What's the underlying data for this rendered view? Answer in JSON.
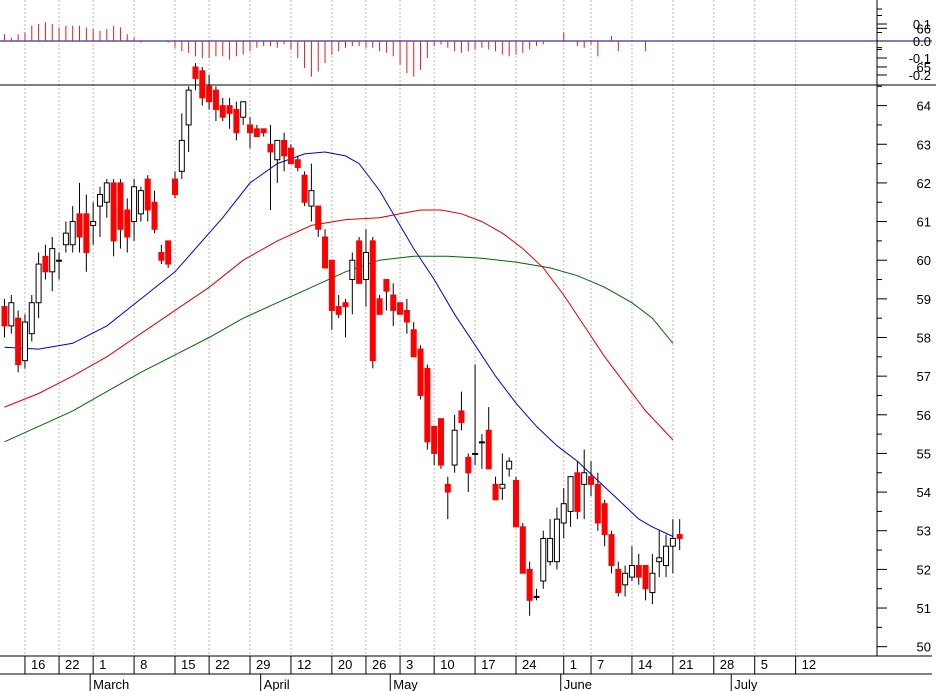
{
  "chart_data": [
    {
      "type": "bar",
      "panel": "oscillator",
      "ylim": [
        -0.25,
        0.15
      ],
      "ticks": [
        0.1,
        0.0,
        -0.1,
        -0.2
      ],
      "tick_labels": [
        "0.1",
        "0.0",
        "-0.1",
        "-0.2"
      ],
      "zero_line": true,
      "colors": {
        "positive": "#e02020",
        "negative": "#e02020",
        "zero_line": "#000080"
      },
      "values": [
        0.04,
        0.02,
        0.04,
        0.05,
        0.09,
        0.1,
        0.11,
        0.1,
        0.08,
        0.09,
        0.09,
        0.09,
        0.08,
        0.07,
        0.06,
        0.07,
        0.09,
        0.08,
        0.04,
        0.02,
        -0.01,
        0.0,
        0.0,
        0.0,
        -0.01,
        -0.04,
        -0.06,
        -0.07,
        -0.09,
        -0.1,
        -0.1,
        -0.09,
        -0.09,
        -0.11,
        -0.09,
        -0.08,
        -0.06,
        -0.04,
        -0.03,
        -0.03,
        -0.04,
        -0.02,
        -0.05,
        -0.1,
        -0.16,
        -0.21,
        -0.18,
        -0.13,
        -0.08,
        -0.06,
        -0.04,
        -0.03,
        -0.03,
        -0.04,
        -0.04,
        -0.06,
        -0.07,
        -0.09,
        -0.14,
        -0.19,
        -0.21,
        -0.17,
        -0.1,
        -0.03,
        -0.02,
        -0.04,
        -0.06,
        -0.07,
        -0.06,
        -0.05,
        -0.04,
        -0.05,
        -0.06,
        -0.08,
        -0.09,
        -0.08,
        -0.07,
        -0.05,
        -0.03,
        -0.02,
        0.0,
        0.0,
        0.05,
        0.0,
        -0.03,
        -0.04,
        -0.02,
        -0.09,
        0.0,
        0.03,
        -0.06,
        0.0,
        0.0,
        0.0,
        -0.06
      ]
    },
    {
      "type": "candlestick",
      "panel": "price",
      "ylim": [
        49.5,
        66.5
      ],
      "y_ticks": [
        50,
        51,
        52,
        53,
        54,
        55,
        56,
        57,
        58,
        59,
        60,
        61,
        62,
        63,
        64,
        65,
        66
      ],
      "y_tick_labels": [
        "50",
        "51",
        "52",
        "53",
        "54",
        "55",
        "56",
        "57",
        "58",
        "59",
        "60",
        "61",
        "62",
        "63",
        "64",
        "65",
        "66"
      ],
      "grid": "vertical dotted",
      "x_day_labels": [
        "16",
        "22",
        "1",
        "8",
        "15",
        "22",
        "29",
        "12",
        "20",
        "26",
        "3",
        "10",
        "17",
        "24",
        "1",
        "7",
        "14",
        "21",
        "28",
        "5",
        "12"
      ],
      "x_day_label_bars": [
        3,
        8,
        13,
        19,
        25,
        30,
        36,
        42,
        48,
        53,
        58,
        63,
        69,
        75,
        82,
        86,
        92,
        98,
        104,
        110,
        116
      ],
      "x_month_labels": [
        "March",
        "April",
        "May",
        "June",
        "July"
      ],
      "x_month_label_bars": [
        13,
        38,
        57,
        82,
        107
      ],
      "colors": {
        "down_body": "#ff0000",
        "up_body": "#ffffff",
        "outline": "#000000",
        "ma_fast": "#0000cc",
        "ma_mid": "#dd0000",
        "ma_slow": "#006600"
      },
      "candles": [
        [
          58.8,
          59.0,
          58.0,
          58.3
        ],
        [
          58.3,
          59.1,
          58.1,
          58.9
        ],
        [
          58.5,
          58.7,
          57.1,
          57.3
        ],
        [
          57.4,
          58.6,
          57.2,
          58.4
        ],
        [
          58.1,
          59.1,
          57.9,
          58.9
        ],
        [
          58.9,
          60.2,
          58.5,
          59.9
        ],
        [
          60.1,
          60.4,
          59.5,
          59.7
        ],
        [
          59.7,
          60.6,
          59.2,
          60.3
        ],
        [
          60.0,
          60.2,
          59.5,
          60.0
        ],
        [
          60.4,
          61.0,
          60.2,
          60.7
        ],
        [
          60.4,
          61.4,
          60.2,
          61.0
        ],
        [
          61.2,
          62.0,
          60.2,
          60.6
        ],
        [
          61.2,
          61.7,
          59.7,
          60.2
        ],
        [
          60.9,
          61.5,
          60.4,
          61.0
        ],
        [
          61.4,
          61.9,
          60.6,
          61.7
        ],
        [
          61.5,
          62.1,
          61.1,
          62.0
        ],
        [
          62.0,
          62.1,
          60.1,
          60.5
        ],
        [
          62.0,
          62.1,
          60.3,
          60.8
        ],
        [
          61.3,
          61.6,
          60.2,
          60.6
        ],
        [
          61.0,
          62.1,
          60.5,
          61.9
        ],
        [
          61.2,
          61.9,
          61.0,
          61.8
        ],
        [
          62.1,
          62.2,
          61.0,
          61.3
        ],
        [
          61.5,
          61.8,
          60.7,
          60.8
        ],
        [
          60.2,
          60.4,
          59.9,
          60.0
        ],
        [
          60.5,
          60.5,
          59.8,
          59.9
        ],
        [
          62.1,
          62.3,
          61.6,
          61.7
        ],
        [
          62.3,
          63.8,
          62.1,
          63.1
        ],
        [
          63.5,
          64.5,
          62.8,
          64.4
        ],
        [
          65.0,
          65.1,
          64.4,
          64.7
        ],
        [
          64.9,
          65.0,
          64.0,
          64.2
        ],
        [
          64.5,
          64.8,
          63.9,
          64.1
        ],
        [
          64.4,
          64.5,
          63.6,
          63.9
        ],
        [
          64.0,
          64.2,
          63.6,
          63.7
        ],
        [
          64.0,
          64.2,
          63.4,
          63.8
        ],
        [
          63.9,
          64.1,
          63.1,
          63.3
        ],
        [
          63.7,
          64.1,
          63.5,
          64.1
        ],
        [
          63.5,
          63.7,
          62.9,
          63.3
        ],
        [
          63.4,
          63.5,
          63.2,
          63.2
        ],
        [
          63.4,
          63.4,
          63.2,
          63.3
        ],
        [
          63.0,
          63.5,
          61.3,
          62.8
        ],
        [
          62.6,
          63.1,
          62.0,
          63.1
        ],
        [
          63.1,
          63.3,
          62.3,
          62.7
        ],
        [
          62.9,
          63.0,
          62.5,
          62.5
        ],
        [
          62.6,
          62.7,
          62.3,
          62.4
        ],
        [
          62.2,
          62.3,
          61.4,
          61.5
        ],
        [
          61.4,
          62.5,
          61.0,
          61.8
        ],
        [
          61.4,
          61.4,
          60.6,
          60.8
        ],
        [
          60.6,
          60.8,
          59.8,
          59.8
        ],
        [
          60.0,
          60.0,
          58.2,
          58.7
        ],
        [
          58.8,
          59.1,
          58.5,
          58.6
        ],
        [
          58.9,
          59.0,
          58.0,
          58.8
        ],
        [
          59.5,
          60.2,
          58.6,
          60.0
        ],
        [
          60.5,
          60.6,
          59.4,
          59.4
        ],
        [
          59.5,
          60.8,
          58.8,
          60.2
        ],
        [
          60.5,
          60.6,
          57.2,
          57.4
        ],
        [
          59.0,
          59.1,
          58.6,
          58.6
        ],
        [
          59.5,
          59.5,
          58.7,
          59.2
        ],
        [
          59.1,
          59.4,
          58.3,
          58.7
        ],
        [
          58.9,
          58.9,
          58.6,
          58.6
        ],
        [
          58.7,
          59.0,
          58.1,
          58.4
        ],
        [
          58.2,
          58.4,
          57.5,
          57.5
        ],
        [
          57.7,
          57.8,
          56.4,
          56.5
        ],
        [
          57.2,
          57.3,
          55.1,
          55.3
        ],
        [
          55.7,
          55.7,
          54.7,
          55.0
        ],
        [
          55.9,
          55.9,
          54.6,
          54.7
        ],
        [
          54.2,
          54.4,
          53.3,
          54.0
        ],
        [
          54.7,
          56.0,
          54.5,
          55.6
        ],
        [
          56.1,
          56.6,
          55.6,
          55.8
        ],
        [
          54.9,
          55.0,
          54.0,
          54.5
        ],
        [
          55.0,
          57.3,
          54.7,
          55.0
        ],
        [
          55.3,
          55.5,
          54.6,
          55.3
        ],
        [
          55.6,
          56.2,
          54.7,
          54.6
        ],
        [
          54.2,
          54.4,
          53.8,
          53.8
        ],
        [
          54.1,
          55.0,
          53.8,
          54.2
        ],
        [
          54.6,
          54.9,
          54.4,
          54.8
        ],
        [
          54.3,
          54.4,
          53.4,
          53.1
        ],
        [
          53.1,
          53.2,
          52.7,
          51.9
        ],
        [
          52.0,
          52.2,
          50.8,
          51.2
        ],
        [
          51.3,
          51.5,
          51.2,
          51.3
        ],
        [
          51.7,
          53.0,
          51.5,
          52.8
        ],
        [
          52.2,
          53.3,
          52.1,
          52.8
        ],
        [
          52.2,
          53.6,
          52.0,
          53.3
        ],
        [
          53.2,
          54.1,
          52.8,
          53.7
        ],
        [
          53.5,
          54.4,
          53.1,
          54.4
        ],
        [
          54.5,
          54.8,
          53.3,
          53.5
        ],
        [
          54.2,
          55.1,
          53.3,
          54.5
        ],
        [
          54.4,
          54.8,
          53.9,
          54.2
        ],
        [
          54.2,
          54.5,
          53.0,
          53.2
        ],
        [
          53.7,
          53.8,
          52.6,
          52.9
        ],
        [
          52.9,
          53.0,
          51.9,
          52.1
        ],
        [
          52.0,
          52.2,
          51.3,
          51.4
        ],
        [
          51.6,
          52.1,
          51.3,
          51.9
        ],
        [
          51.8,
          52.6,
          51.7,
          52.1
        ],
        [
          52.1,
          52.4,
          51.6,
          51.8
        ],
        [
          52.1,
          52.1,
          51.2,
          51.5
        ],
        [
          51.4,
          52.4,
          51.1,
          51.9
        ],
        [
          52.2,
          53.0,
          51.8,
          52.3
        ],
        [
          52.1,
          52.9,
          51.8,
          52.6
        ],
        [
          52.6,
          53.3,
          51.9,
          52.8
        ],
        [
          52.9,
          53.3,
          52.5,
          52.8
        ]
      ],
      "moving_averages": [
        {
          "color": "#0000cc",
          "points": [
            [
              0,
              57.75
            ],
            [
              5,
              57.7
            ],
            [
              10,
              57.85
            ],
            [
              15,
              58.3
            ],
            [
              20,
              59.0
            ],
            [
              25,
              59.7
            ],
            [
              28,
              60.3
            ],
            [
              32,
              61.1
            ],
            [
              36,
              62.0
            ],
            [
              40,
              62.5
            ],
            [
              44,
              62.75
            ],
            [
              47,
              62.8
            ],
            [
              50,
              62.7
            ],
            [
              52,
              62.5
            ],
            [
              55,
              61.8
            ],
            [
              57,
              61.2
            ],
            [
              60,
              60.3
            ],
            [
              63,
              59.5
            ],
            [
              66,
              58.6
            ],
            [
              69,
              57.8
            ],
            [
              72,
              57.0
            ],
            [
              75,
              56.3
            ],
            [
              78,
              55.7
            ],
            [
              81,
              55.2
            ],
            [
              84,
              54.8
            ],
            [
              87,
              54.3
            ],
            [
              90,
              53.8
            ],
            [
              93,
              53.3
            ],
            [
              95,
              53.1
            ],
            [
              98,
              52.85
            ]
          ]
        },
        {
          "color": "#dd0000",
          "points": [
            [
              0,
              56.2
            ],
            [
              5,
              56.55
            ],
            [
              10,
              57.0
            ],
            [
              15,
              57.5
            ],
            [
              20,
              58.1
            ],
            [
              25,
              58.7
            ],
            [
              30,
              59.3
            ],
            [
              35,
              60.0
            ],
            [
              40,
              60.5
            ],
            [
              45,
              60.9
            ],
            [
              50,
              61.05
            ],
            [
              55,
              61.1
            ],
            [
              58,
              61.2
            ],
            [
              61,
              61.3
            ],
            [
              64,
              61.3
            ],
            [
              67,
              61.2
            ],
            [
              70,
              61.0
            ],
            [
              73,
              60.7
            ],
            [
              76,
              60.3
            ],
            [
              79,
              59.8
            ],
            [
              82,
              59.1
            ],
            [
              85,
              58.3
            ],
            [
              88,
              57.5
            ],
            [
              91,
              56.8
            ],
            [
              94,
              56.1
            ],
            [
              98,
              55.35
            ]
          ]
        },
        {
          "color": "#006600",
          "points": [
            [
              0,
              55.3
            ],
            [
              5,
              55.7
            ],
            [
              10,
              56.1
            ],
            [
              15,
              56.6
            ],
            [
              20,
              57.1
            ],
            [
              25,
              57.55
            ],
            [
              30,
              58.0
            ],
            [
              35,
              58.5
            ],
            [
              40,
              58.9
            ],
            [
              45,
              59.3
            ],
            [
              50,
              59.7
            ],
            [
              55,
              60.0
            ],
            [
              60,
              60.1
            ],
            [
              65,
              60.1
            ],
            [
              70,
              60.05
            ],
            [
              75,
              59.95
            ],
            [
              80,
              59.8
            ],
            [
              84,
              59.6
            ],
            [
              88,
              59.3
            ],
            [
              92,
              58.9
            ],
            [
              95,
              58.5
            ],
            [
              98,
              57.85
            ]
          ]
        }
      ]
    }
  ]
}
